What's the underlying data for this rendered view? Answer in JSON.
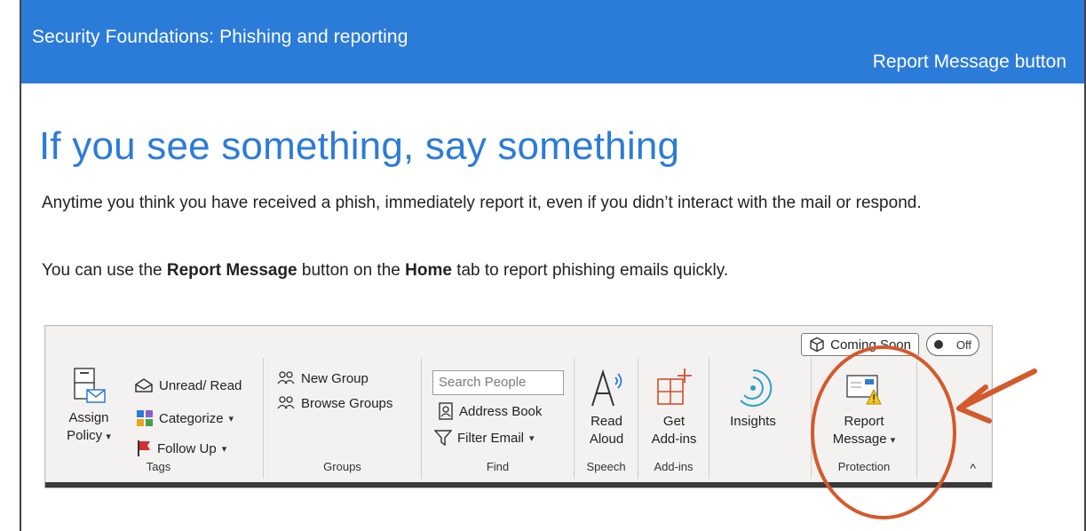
{
  "header": {
    "course_title": "Security Foundations: Phishing and reporting",
    "section_title": "Report Message button"
  },
  "content": {
    "headline": "If you see something, say something",
    "para1": "Anytime you think you have received a phish, immediately report it, even if you didn’t interact with the mail or respond.",
    "para2_prefix": "You can use the ",
    "para2_bold1": "Report Message",
    "para2_middle": " button on the ",
    "para2_bold2": "Home",
    "para2_suffix": " tab to report phishing emails quickly."
  },
  "ribbon": {
    "coming_soon": "Coming Soon",
    "toggle": "Off",
    "groups": {
      "tags": {
        "label": "Tags",
        "assign_policy": [
          "Assign",
          "Policy"
        ],
        "unread_read": "Unread/ Read",
        "categorize": "Categorize",
        "follow_up": "Follow Up"
      },
      "groups": {
        "label": "Groups",
        "new_group": "New Group",
        "browse_groups": "Browse Groups"
      },
      "find": {
        "label": "Find",
        "search_placeholder": "Search People",
        "address_book": "Address Book",
        "filter_email": "Filter Email"
      },
      "speech": {
        "label": "Speech",
        "read_aloud": [
          "Read",
          "Aloud"
        ]
      },
      "addins": {
        "label": "Add-ins",
        "get_addins": [
          "Get",
          "Add-ins"
        ]
      },
      "insights": {
        "label": "Insights"
      },
      "protection": {
        "label": "Protection",
        "report_message": [
          "Report",
          "Message"
        ]
      }
    },
    "caret": "▾",
    "collapse": "^"
  },
  "colors": {
    "brand_blue": "#2b7bd9",
    "annotation": "#d35a2b"
  },
  "icons": [
    "assign-policy-icon",
    "envelope-open-icon",
    "categorize-icon",
    "flag-icon",
    "people-icon",
    "address-book-icon",
    "filter-icon",
    "read-aloud-icon",
    "get-addins-icon",
    "insights-icon",
    "report-message-icon",
    "cube-icon"
  ]
}
